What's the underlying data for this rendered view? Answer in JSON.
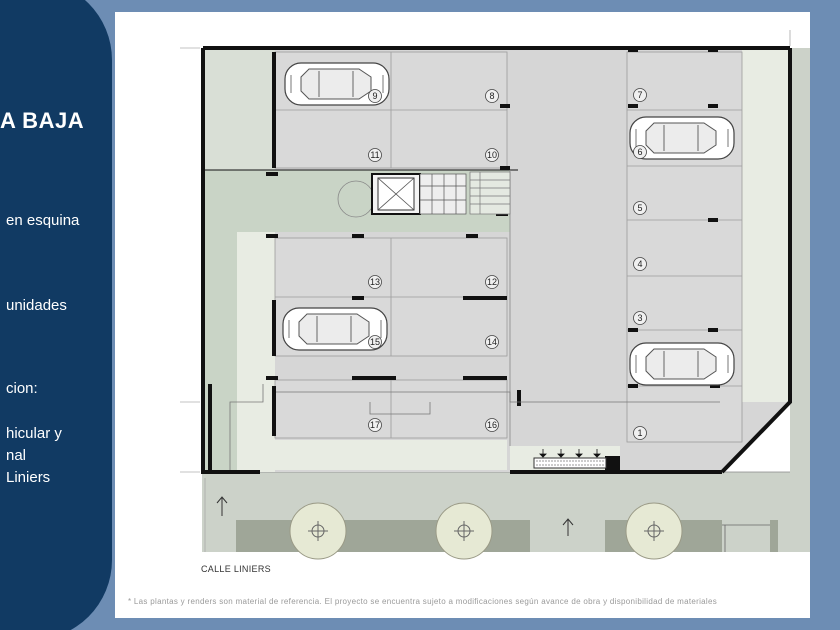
{
  "sidebar": {
    "title": "A BAJA",
    "lines": [
      "en esquina",
      "unidades",
      "cion:",
      "hicular y",
      "nal",
      "Liniers"
    ]
  },
  "plan": {
    "street_label": "CALLE LINIERS",
    "parking_spaces": [
      "1",
      "3",
      "4",
      "5",
      "6",
      "7",
      "8",
      "9",
      "10",
      "11",
      "12",
      "13",
      "14",
      "15",
      "16",
      "17"
    ]
  },
  "footnote": "* Las plantas y renders son material de referencia. El proyecto se encuentra sujeto a modificaciones según avance de obra y disponibilidad de materiales",
  "colors": {
    "navy": "#113a63",
    "frame_blue": "#6d8db4",
    "paving": "#dcdcdc",
    "garden": "#c9d4c6",
    "wall": "#111111"
  },
  "icons": [
    "car-icon",
    "tree-icon",
    "elevator-icon",
    "stairs-icon",
    "arrow-icon"
  ]
}
